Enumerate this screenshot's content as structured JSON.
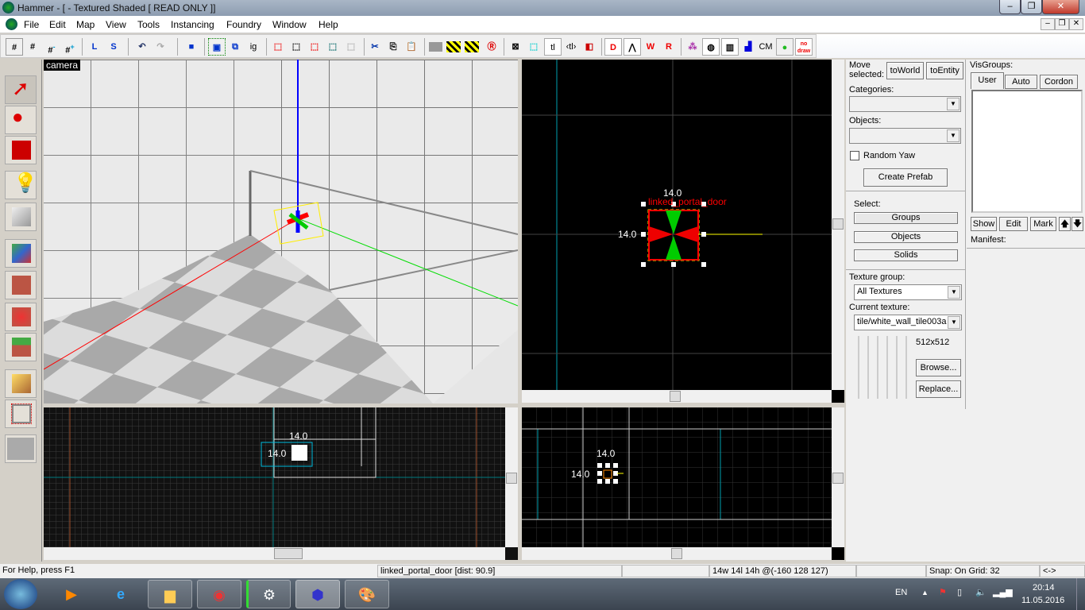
{
  "window": {
    "title": "Hammer - [ - Textured Shaded [ READ ONLY ]]",
    "min": "–",
    "max": "❐",
    "close": "✕"
  },
  "menu": [
    "File",
    "Edit",
    "Map",
    "View",
    "Tools",
    "Instancing",
    "Foundry",
    "Window",
    "Help"
  ],
  "toolbar": {
    "items": [
      "grid",
      "3D grid",
      "grid-",
      "grid+",
      "L",
      "S",
      "undo",
      "redo",
      "carve",
      "group",
      "ungroup",
      "ig",
      "hide",
      "hide-unselected",
      "show",
      "hide-all",
      "show-all",
      "cut",
      "copy",
      "paste",
      "gray",
      "tiled",
      "tiled-x",
      "R",
      "bbox",
      "select-rect",
      "tl",
      "<tl>",
      "flip",
      "DD",
      "3D",
      "W",
      "DR",
      "brush",
      "sphere",
      "M",
      "pixel",
      "CM",
      "leaf",
      "no draw"
    ],
    "text_items": {
      "ig": "ig",
      "tl": "tl",
      "tl2": "‹tl›",
      "cm": "CM",
      "nodraw": "no draw"
    }
  },
  "camera": {
    "label": "camera"
  },
  "top_view": {
    "selection_label": "linked_portal_door",
    "width": "14.0",
    "height": "14.0"
  },
  "side_view": {
    "width": "14.0",
    "height": "14.0"
  },
  "front_view": {
    "width": "14.0",
    "height": "14.0"
  },
  "panel": {
    "move_selected": "Move selected:",
    "to_world": "toWorld",
    "to_entity": "toEntity",
    "categories": "Categories:",
    "objects": "Objects:",
    "random_yaw": "Random Yaw",
    "random_yaw_checked": false,
    "create_prefab": "Create Prefab",
    "select": "Select:",
    "groups": "Groups",
    "objects_btn": "Objects",
    "solids": "Solids",
    "texture_group_label": "Texture group:",
    "texture_group": "All Textures",
    "current_texture_label": "Current texture:",
    "current_texture": "tile/white_wall_tile003a",
    "texture_size": "512x512",
    "browse": "Browse...",
    "replace": "Replace..."
  },
  "visgroups": {
    "label": "VisGroups:",
    "tabs": [
      "User",
      "Auto",
      "Cordon"
    ],
    "active_tab": "User",
    "show": "Show",
    "edit": "Edit",
    "mark": "Mark",
    "up": "🡅",
    "down": "🡇",
    "manifest": "Manifest:"
  },
  "status": {
    "help": "For Help, press F1",
    "selection": "linked_portal_door  [dist: 90.9]",
    "size": "14w 14l 14h @(-160 128 127)",
    "snap": "Snap: On Grid: 32",
    "nav": "<->"
  },
  "taskbar": {
    "lang": "EN",
    "time": "20:14",
    "date": "11.05.2016"
  },
  "colors": {
    "accent_select": "#ff0000",
    "axis_x": "#ff0000",
    "axis_y": "#00ff00",
    "axis_z": "#0000ff",
    "grid": "#3a3a3a",
    "grid_major": "#00a0b0"
  }
}
